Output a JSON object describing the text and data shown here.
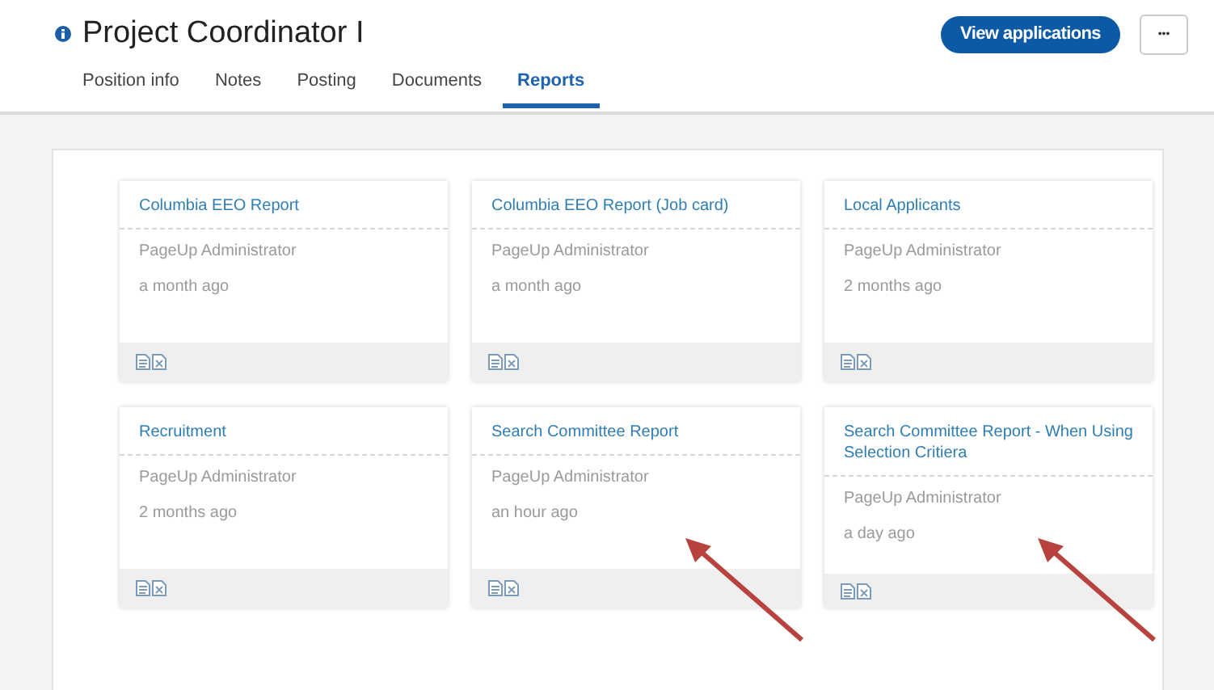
{
  "header": {
    "title": "Project Coordinator I",
    "primary_button": "View applications",
    "more_button": "•••"
  },
  "tabs": [
    {
      "label": "Position info",
      "selected": false
    },
    {
      "label": "Notes",
      "selected": false
    },
    {
      "label": "Posting",
      "selected": false
    },
    {
      "label": "Documents",
      "selected": false
    },
    {
      "label": "Reports",
      "selected": true
    }
  ],
  "reports": [
    {
      "title": "Columbia EEO Report",
      "author": "PageUp Administrator",
      "time": "a month ago",
      "marked": false
    },
    {
      "title": "Columbia EEO Report (Job card)",
      "author": "PageUp Administrator",
      "time": "a month ago",
      "marked": false
    },
    {
      "title": "Local Applicants",
      "author": "PageUp Administrator",
      "time": "2 months ago",
      "marked": false
    },
    {
      "title": "Recruitment",
      "author": "PageUp Administrator",
      "time": "2 months ago",
      "marked": false
    },
    {
      "title": "Search Committee Report",
      "author": "PageUp Administrator",
      "time": "an hour ago",
      "marked": true
    },
    {
      "title": "Search Committee Report - When Using Selection Critiera",
      "author": "PageUp Administrator",
      "time": "a day ago",
      "marked": true
    }
  ]
}
